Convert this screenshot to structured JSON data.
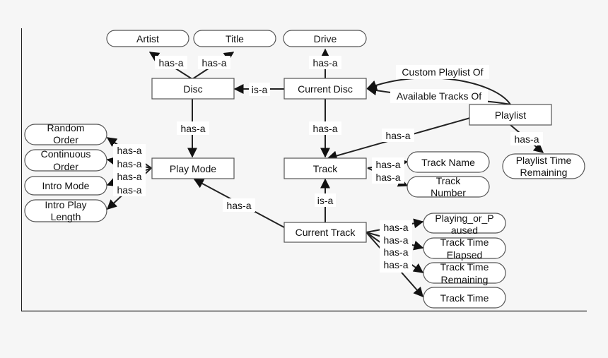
{
  "diagram": {
    "nodes": {
      "artist": "Artist",
      "title": "Title",
      "drive": "Drive",
      "disc": "Disc",
      "current_disc": "Current Disc",
      "playlist": "Playlist",
      "random_order": [
        "Random",
        "Order"
      ],
      "continuous_order": [
        "Continuous",
        "Order"
      ],
      "intro_mode": "Intro Mode",
      "intro_play_length": [
        "Intro Play",
        "Length"
      ],
      "play_mode": "Play Mode",
      "track": "Track",
      "track_name": "Track Name",
      "track_number": [
        "Track",
        "Number"
      ],
      "playlist_time_remaining": [
        "Playlist Time",
        "Remaining"
      ],
      "current_track": "Current Track",
      "playing_or_paused": [
        "Playing_or_P",
        "aused"
      ],
      "track_time_elapsed": [
        "Track Time",
        "Elapsed"
      ],
      "track_time_remaining": [
        "Track Time",
        "Remaining"
      ],
      "track_time": "Track Time"
    },
    "edges": {
      "has_a": "has-a",
      "is_a": "is-a",
      "custom_playlist_of": "Custom Playlist Of",
      "available_tracks_of": "Available Tracks Of"
    }
  }
}
